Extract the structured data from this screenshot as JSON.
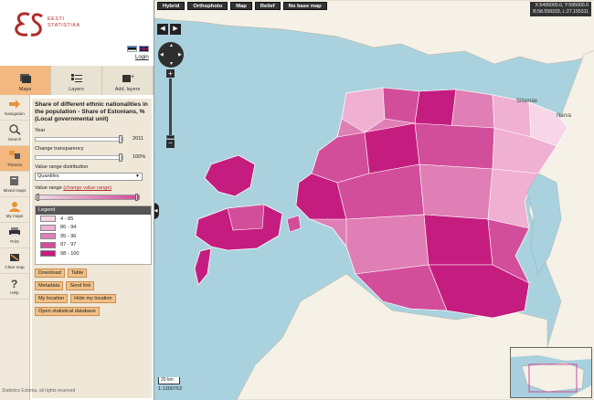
{
  "app": {
    "logo_line1": "EESTI",
    "logo_line2": "STATISTIKA",
    "login_label": "Login"
  },
  "tabs": [
    {
      "label": "Maps",
      "icon": "maps-icon"
    },
    {
      "label": "Layers",
      "icon": "layers-icon"
    },
    {
      "label": "Add. layers",
      "icon": "add-layers-icon"
    }
  ],
  "side_nav": [
    {
      "label": "Navigation",
      "icon": "navigation-icon"
    },
    {
      "label": "Search",
      "icon": "search-icon"
    },
    {
      "label": "Themes",
      "icon": "themes-icon"
    },
    {
      "label": "Mixed maps",
      "icon": "mixed-maps-icon"
    },
    {
      "label": "My maps",
      "icon": "my-maps-icon"
    },
    {
      "label": "Print",
      "icon": "print-icon"
    },
    {
      "label": "Clear map",
      "icon": "clear-map-icon"
    },
    {
      "label": "Help",
      "icon": "help-icon"
    }
  ],
  "panel": {
    "title": "Share of different ethnic nationalities in the population - Share of Estonians, % (Local governmental unit)",
    "year_label": "Year",
    "year_value": "2011",
    "transparency_label": "Change transparency",
    "transparency_value": "100%",
    "transparency_fraction": 1.0,
    "year_fraction": 1.0,
    "distribution_label": "Value range distribution",
    "distribution_value": "Quantiles",
    "value_range_label": "Value range",
    "value_range_link": "(change value range)",
    "legend_title": "Legend",
    "legend": [
      {
        "label": "4 - 85",
        "color": "#f6d6e7"
      },
      {
        "label": "86 - 94",
        "color": "#efb0d2"
      },
      {
        "label": "95 - 96",
        "color": "#e07fb5"
      },
      {
        "label": "97 - 97",
        "color": "#d24e9b"
      },
      {
        "label": "98 - 100",
        "color": "#c41d7f"
      }
    ],
    "buttons": {
      "download": "Download",
      "table": "Table",
      "metadata": "Metadata",
      "send_link": "Send link",
      "my_location": "My location",
      "hide_my_location": "Hide my location",
      "open_db": "Open statistical database"
    },
    "footer": "Statistics Estonia, all rights reserved"
  },
  "map": {
    "basemaps": [
      "Hybrid",
      "Orthophoto",
      "Map",
      "Relief",
      "No base map"
    ],
    "coords_line1": "X:6495000.0, Y:595000.0",
    "coords_line2": "B:58.558333, L:27.155311",
    "scale_label": "20 km",
    "scale_ratio": "1:1300763",
    "place_narva": "Narva",
    "place_sillamae": "Sillamäe"
  }
}
